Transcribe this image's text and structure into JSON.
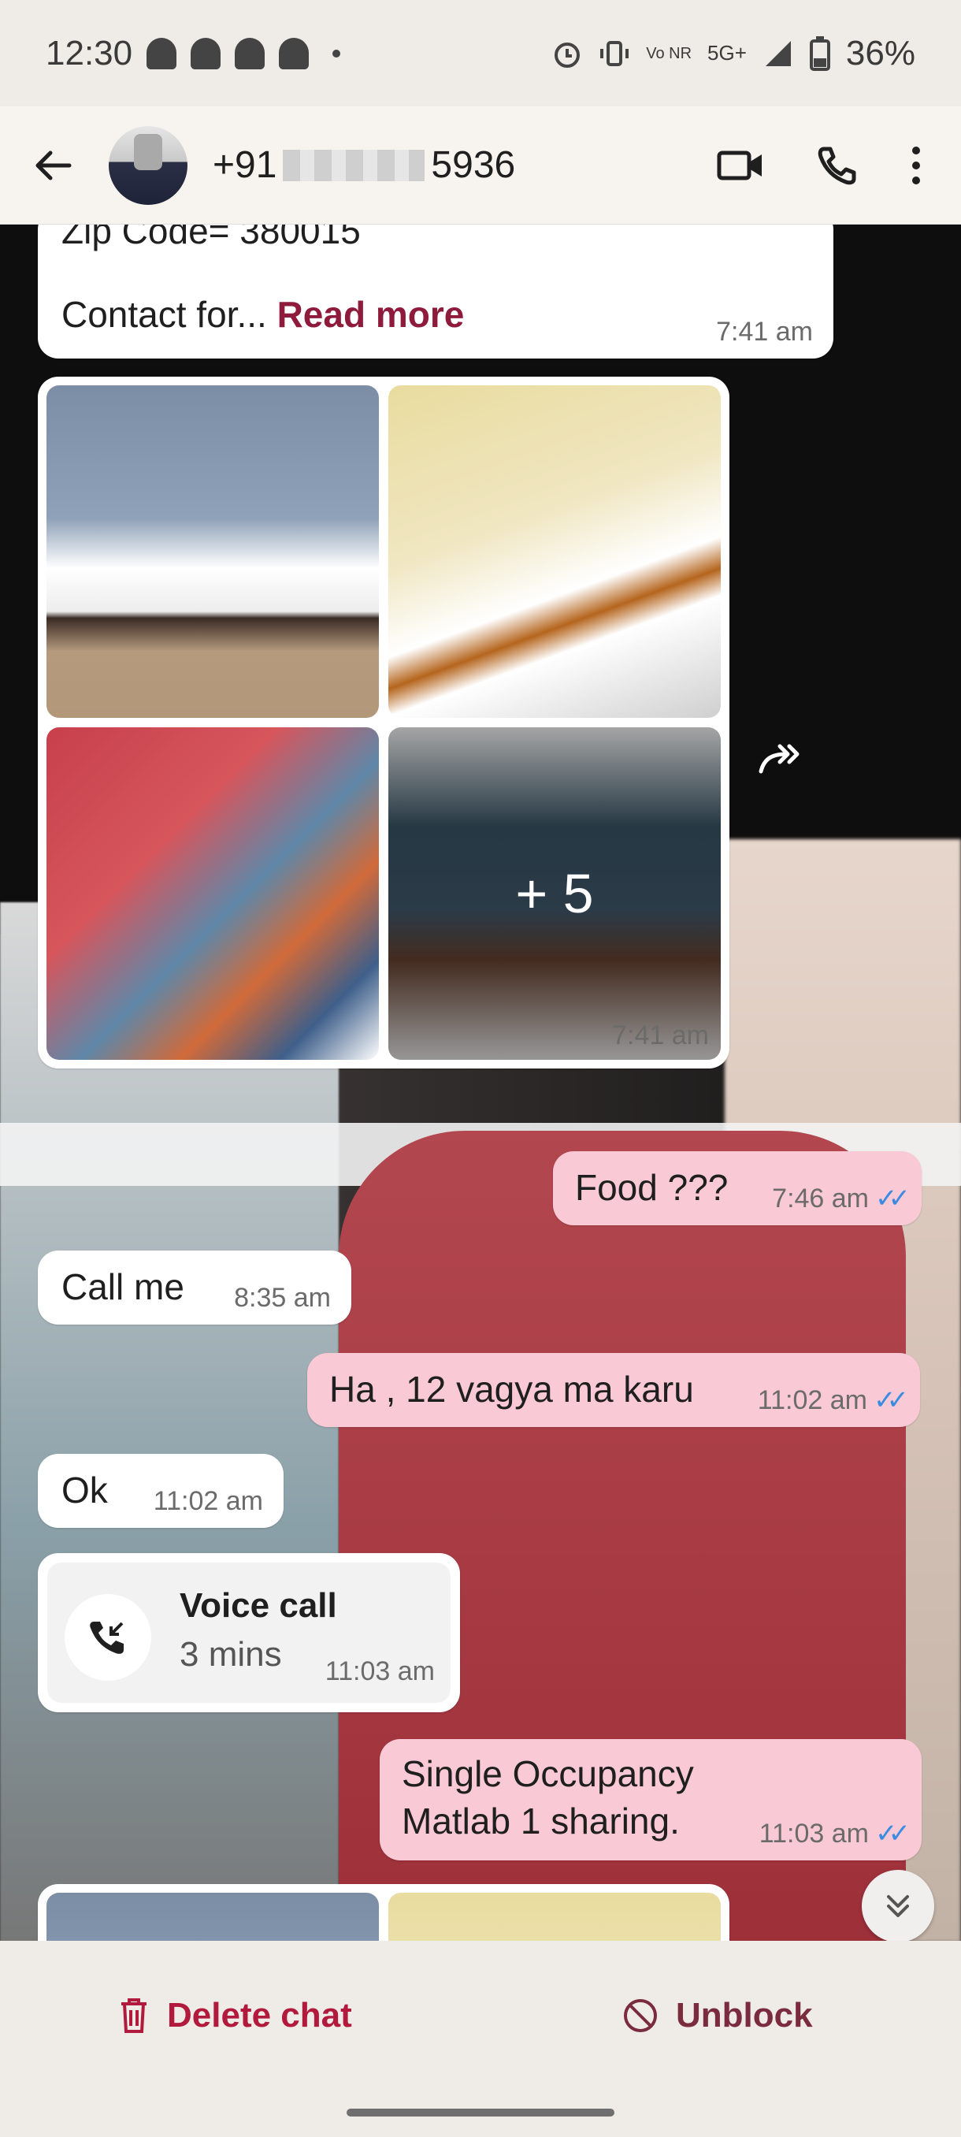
{
  "status_bar": {
    "time": "12:30",
    "battery": "36%",
    "network": "5G+",
    "volte": "Vo NR"
  },
  "header": {
    "contact_prefix": "+91",
    "contact_suffix": "5936",
    "icons": [
      "back-arrow-icon",
      "video-call-icon",
      "phone-icon",
      "more-vert-icon"
    ]
  },
  "messages": {
    "m1": {
      "line1": "Zip Code= 380015",
      "line2": "Contact for...",
      "read_more": "Read more",
      "time": "7:41 am"
    },
    "media1": {
      "more": "+ 5",
      "time": "7:41 am"
    },
    "m2": {
      "text": "Food ???",
      "time": "7:46 am"
    },
    "m3": {
      "text": "Call me",
      "time": "8:35 am"
    },
    "m4": {
      "text": "Ha , 12 vagya ma karu",
      "time": "11:02 am"
    },
    "m5": {
      "text": "Ok",
      "time": "11:02 am"
    },
    "call": {
      "title": "Voice call",
      "duration": "3 mins",
      "time": "11:03 am"
    },
    "m6": {
      "line1": "Single Occupancy",
      "line2": "Matlab 1 sharing.",
      "time": "11:03 am"
    }
  },
  "footer": {
    "delete_label": "Delete chat",
    "unblock_label": "Unblock"
  },
  "colors": {
    "accent": "#b21a3d",
    "outgoing_bubble": "#f9c9d6",
    "read_ticks": "#3b8be0"
  }
}
